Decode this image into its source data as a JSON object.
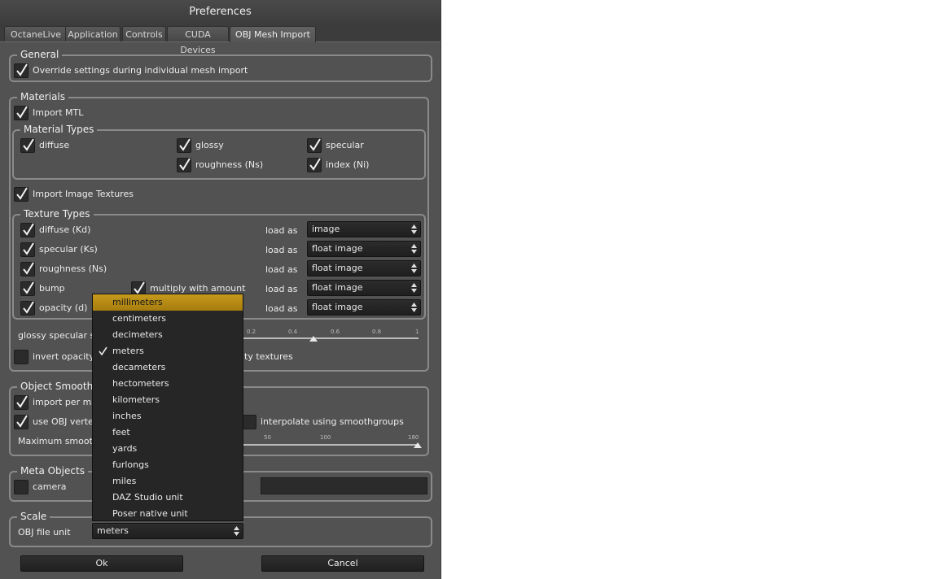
{
  "window": {
    "title": "Preferences"
  },
  "tabs": [
    "OctaneLive",
    "Application",
    "Controls",
    "CUDA Devices",
    "OBJ Mesh Import"
  ],
  "general": {
    "title": "General",
    "override_label": "Override settings during individual mesh import",
    "override_checked": true
  },
  "materials": {
    "title": "Materials",
    "import_mtl": "Import MTL",
    "types_title": "Material Types",
    "diffuse": "diffuse",
    "glossy": "glossy",
    "specular": "specular",
    "roughness": "roughness (Ns)",
    "index": "index (Ni)",
    "import_textures": "Import Image Textures",
    "tex_title": "Texture Types",
    "load_as": "load as",
    "tex_diffuse": "diffuse (Kd)",
    "tex_specular": "specular (Ks)",
    "tex_roughness": "roughness (Ns)",
    "tex_bump": "bump",
    "tex_multiply": "multiply with amount",
    "tex_opacity": "opacity (d)",
    "combo_values": [
      "image",
      "float image",
      "float image",
      "float image",
      "float image"
    ],
    "glossy_scale_label": "glossy specular sca",
    "glossy_ticks": [
      "0.2",
      "0.4",
      "0.6",
      "0.8",
      "1"
    ],
    "invert_label": "invert opacity v",
    "invert_suffix": "ty textures"
  },
  "smoothing": {
    "title": "Object Smoothin",
    "import_per": "import per mate",
    "use_obj": "use OBJ vertex",
    "interpolate": "interpolate using smoothgroups",
    "max_smooth": "Maximum smooth a",
    "ticks": [
      "50",
      "100",
      "180"
    ]
  },
  "meta": {
    "title": "Meta Objects",
    "camera": "camera"
  },
  "scale": {
    "title": "Scale",
    "obj_unit_label": "OBJ file unit",
    "selected": "meters"
  },
  "unit_options": [
    "millimeters",
    "centimeters",
    "decimeters",
    "meters",
    "decameters",
    "hectometers",
    "kilometers",
    "inches",
    "feet",
    "yards",
    "furlongs",
    "miles",
    "DAZ Studio unit",
    "Poser native unit"
  ],
  "highlighted_option": "millimeters",
  "buttons": {
    "ok": "Ok",
    "cancel": "Cancel"
  },
  "colors": {
    "background": "#525252",
    "highlight": "#b88d16",
    "combo": "#262626"
  }
}
